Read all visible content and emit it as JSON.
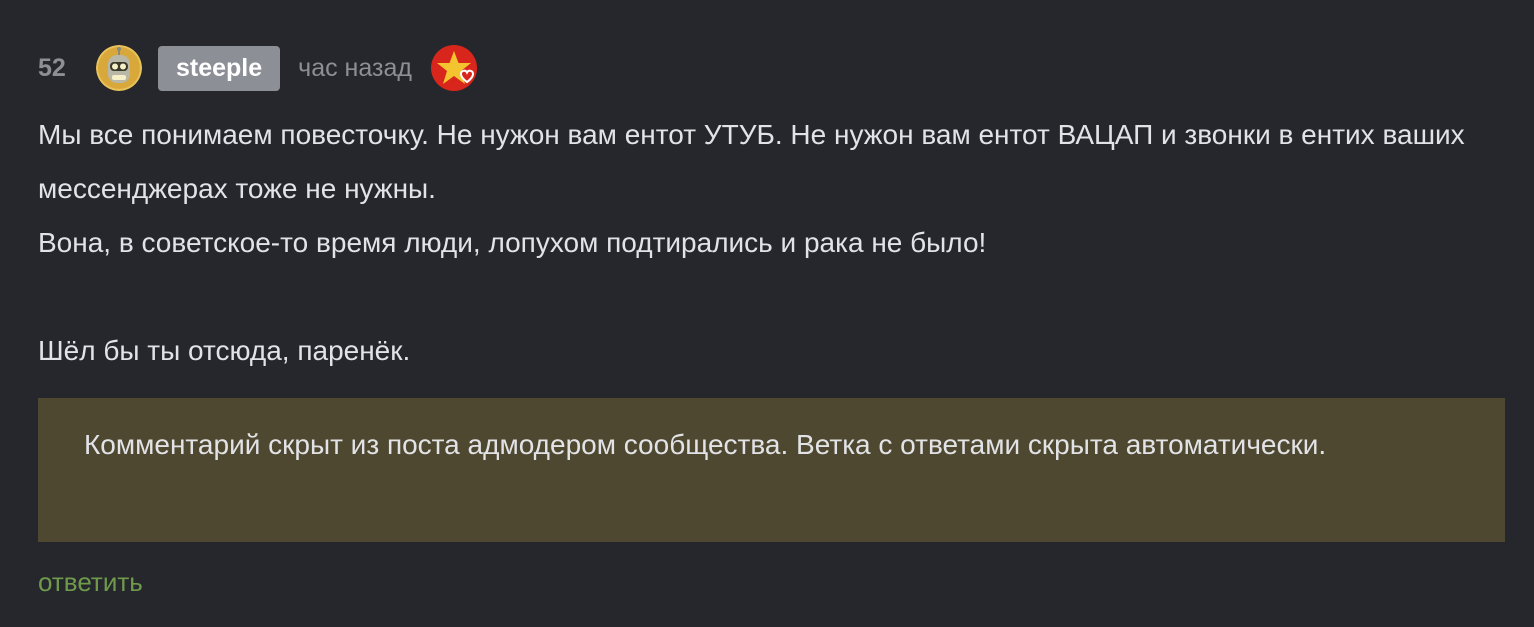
{
  "comment": {
    "rating": "52",
    "username": "steeple",
    "time": "час назад",
    "body": [
      "Мы все понимаем повесточку. Не нужон вам ентот УТУБ. Не нужон вам ентот ВАЦАП и звонки в ентих ваших мессенджерах тоже не нужны.",
      "Вона, в советское-то время люди, лопухом подтирались и рака не было!",
      "Шёл бы ты отсюда, паренёк."
    ],
    "hidden_notice": "Комментарий скрыт из поста адмодером сообщества. Ветка с ответами скрыта автоматически.",
    "reply_label": "ответить"
  },
  "colors": {
    "background": "#26272c",
    "text": "#e2e3e6",
    "muted": "#8d8f96",
    "notice_bg": "#4f4830",
    "reply": "#6f9a4c"
  },
  "icons": {
    "avatar": "bender-avatar",
    "award": "red-star-heart-award"
  }
}
